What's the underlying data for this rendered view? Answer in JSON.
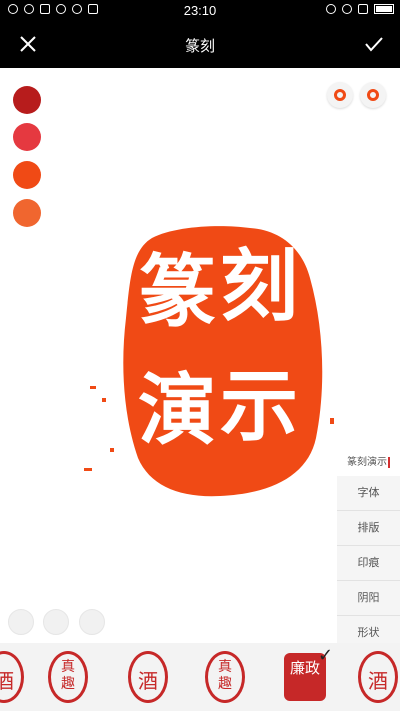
{
  "status_bar": {
    "time": "23:10"
  },
  "header": {
    "title": "篆刻"
  },
  "palette": {
    "colors": [
      "#b71c1c",
      "#e53940",
      "#f04a15",
      "#f0662f"
    ]
  },
  "seal": {
    "color": "#f04a15",
    "characters": [
      "篆",
      "刻",
      "演",
      "示"
    ]
  },
  "text_preview": "篆刻演示",
  "menu": {
    "items": [
      "字体",
      "排版",
      "印痕",
      "阴阳",
      "形状"
    ]
  },
  "templates": [
    {
      "name": "template-1",
      "text": "酒"
    },
    {
      "name": "template-2",
      "text": "真趣"
    },
    {
      "name": "template-3",
      "text": "酒"
    },
    {
      "name": "template-4",
      "text": "真趣"
    },
    {
      "name": "template-5",
      "text": "廉政"
    },
    {
      "name": "template-6",
      "text": "酒"
    }
  ]
}
